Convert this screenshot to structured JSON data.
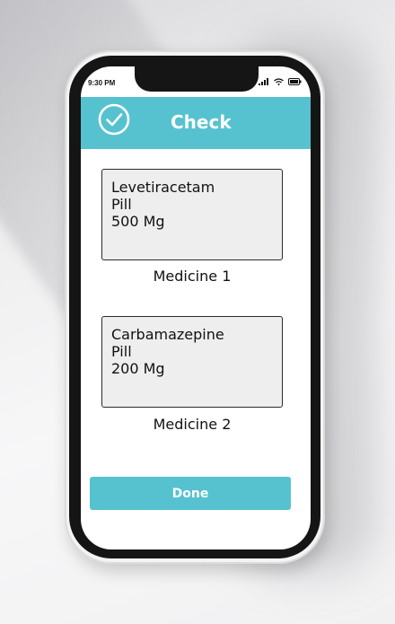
{
  "status_bar": {
    "time": "9:30 PM"
  },
  "header": {
    "title": "Check",
    "icon": "check-circle-icon",
    "color": "#56c2cf"
  },
  "medicines": [
    {
      "name": "Levetiracetam",
      "form": "Pill",
      "dose": "500 Mg",
      "label": "Medicine 1"
    },
    {
      "name": "Carbamazepine",
      "form": "Pill",
      "dose": "200 Mg",
      "label": "Medicine 2"
    }
  ],
  "done_button": {
    "label": "Done"
  }
}
